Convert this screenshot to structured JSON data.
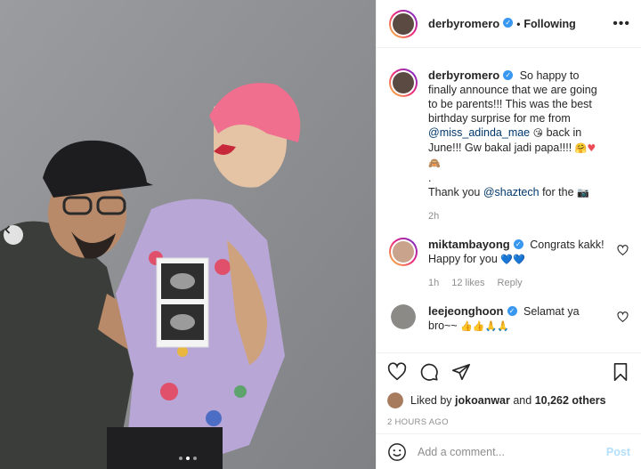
{
  "post": {
    "username": "derbyromero",
    "follow_status": "Following",
    "more_label": "•••"
  },
  "caption": {
    "username": "derbyromero",
    "text_1": "So happy to finally announce that we are going to be parents!!! This was the best birthday surprise for me from",
    "mention_1": "@miss_adinda_mae",
    "text_2": "back in June!!! Gw bakal jadi papa!!!!",
    "line_dot": ".",
    "text_3": "Thank you",
    "mention_2": "@shaztech",
    "text_4": "for the",
    "age": "2h"
  },
  "comments": [
    {
      "username": "miktambayong",
      "text": "Congrats kakk! Happy for you",
      "emoji": "💙💙",
      "age": "1h",
      "likes": "12 likes",
      "reply": "Reply"
    },
    {
      "username": "leejeonghoon",
      "text": "Selamat ya bro~~",
      "emoji": "👍👍🙏🙏"
    }
  ],
  "likes": {
    "prefix": "Liked by",
    "user": "jokoanwar",
    "and": "and",
    "others": "10,262 others"
  },
  "timestamp": "2 HOURS AGO",
  "add_comment": {
    "placeholder": "Add a comment...",
    "post_label": "Post"
  },
  "carousel": {
    "slide_count": 3,
    "active_index": 2
  },
  "colors": {
    "verified": "#3897f0",
    "heart_red": "#ed4956",
    "link": "#00376b",
    "post_disabled": "#b2dffc"
  }
}
